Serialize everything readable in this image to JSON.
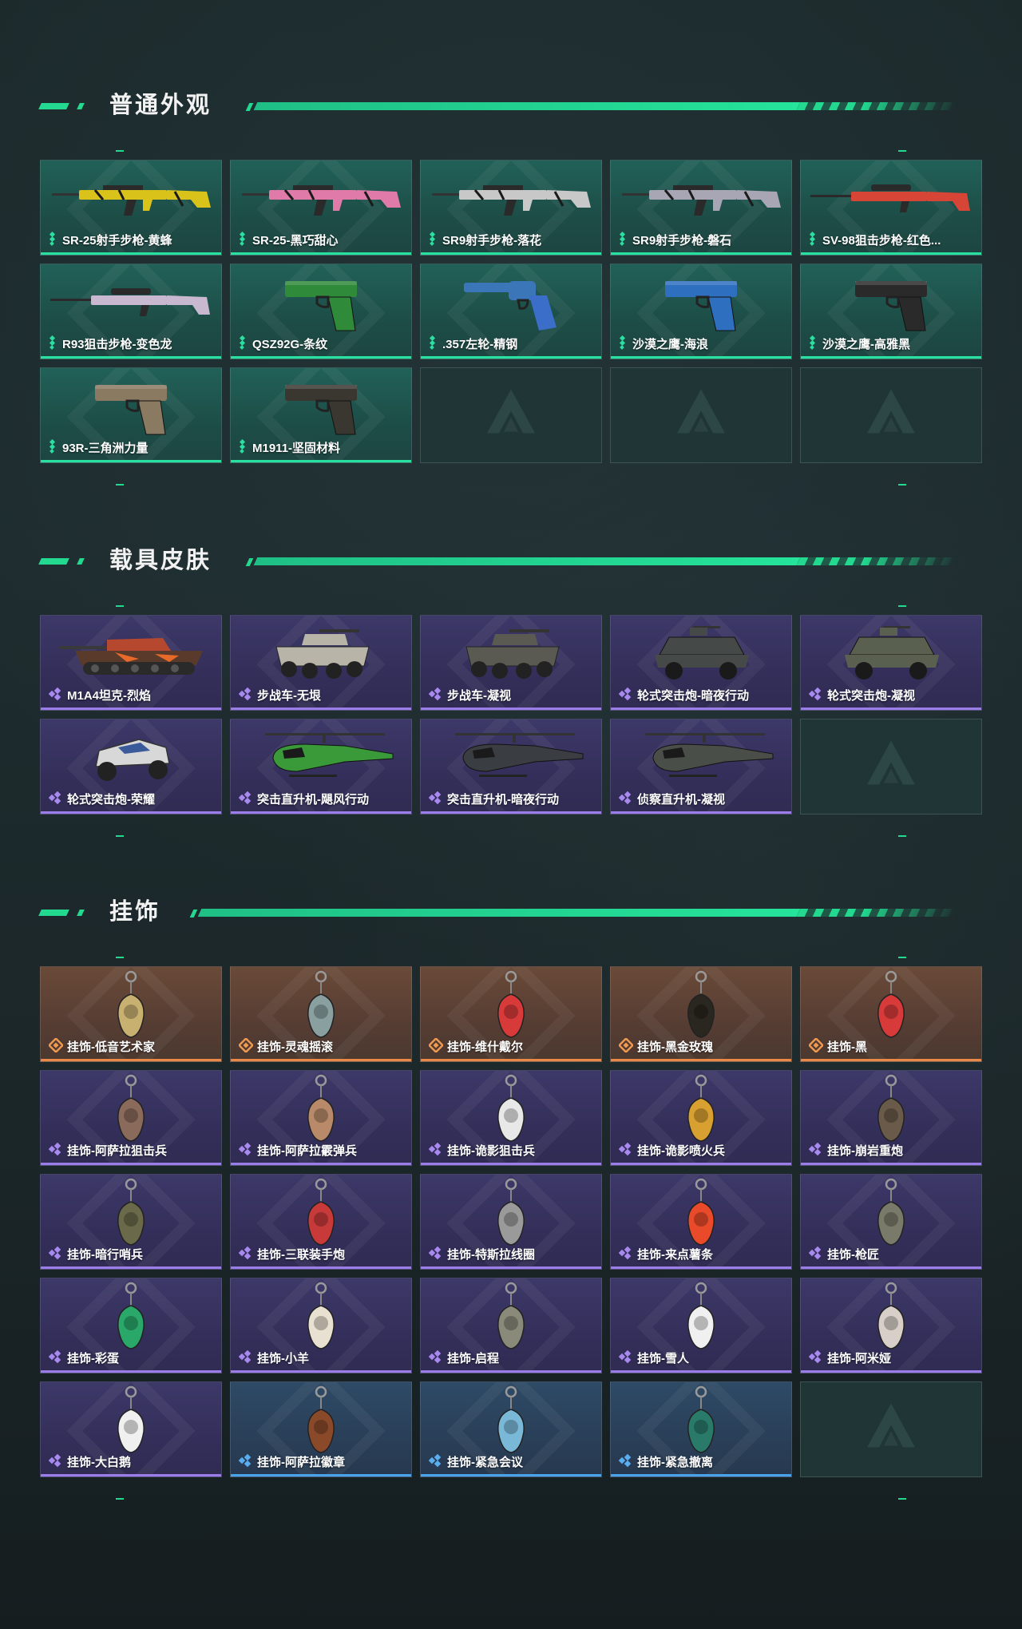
{
  "sections": [
    {
      "title": "普通外观",
      "cards": [
        {
          "label": "SR-25射手步枪-黄蜂",
          "rarity": "green",
          "icon": "rifle-icon",
          "color": "#d9c21a"
        },
        {
          "label": "SR-25-黑巧甜心",
          "rarity": "green",
          "icon": "rifle-icon",
          "color": "#e07aa8"
        },
        {
          "label": "SR9射手步枪-落花",
          "rarity": "green",
          "icon": "rifle-icon",
          "color": "#c8c8c8"
        },
        {
          "label": "SR9射手步枪-磐石",
          "rarity": "green",
          "icon": "rifle-icon",
          "color": "#a8a6b4"
        },
        {
          "label": "SV-98狙击步枪-红色...",
          "rarity": "green",
          "icon": "sniper-icon",
          "color": "#d64535"
        },
        {
          "label": "R93狙击步枪-变色龙",
          "rarity": "green",
          "icon": "sniper-icon",
          "color": "#c8b8d0"
        },
        {
          "label": "QSZ92G-条纹",
          "rarity": "green",
          "icon": "pistol-icon",
          "color": "#2f8a3a"
        },
        {
          "label": ".357左轮-精钢",
          "rarity": "green",
          "icon": "revolver-icon",
          "color": "#3a76b8"
        },
        {
          "label": "沙漠之鹰-海浪",
          "rarity": "green",
          "icon": "pistol-icon",
          "color": "#2f6fc0"
        },
        {
          "label": "沙漠之鹰-高雅黑",
          "rarity": "green",
          "icon": "pistol-icon",
          "color": "#2a2a2a"
        },
        {
          "label": "93R-三角洲力量",
          "rarity": "green",
          "icon": "pistol-icon",
          "color": "#8a7a62"
        },
        {
          "label": "M1911-坚固材料",
          "rarity": "green",
          "icon": "pistol-icon",
          "color": "#3a3630"
        },
        {
          "label": "",
          "rarity": "empty"
        },
        {
          "label": "",
          "rarity": "empty"
        },
        {
          "label": "",
          "rarity": "empty"
        }
      ]
    },
    {
      "title": "载具皮肤",
      "cards": [
        {
          "label": "M1A4坦克-烈焰",
          "rarity": "purple",
          "icon": "tank-icon",
          "color": "#b5482e"
        },
        {
          "label": "步战车-无垠",
          "rarity": "purple",
          "icon": "ifv-icon",
          "color": "#b8b4a8"
        },
        {
          "label": "步战车-凝视",
          "rarity": "purple",
          "icon": "ifv-icon",
          "color": "#5a5a52"
        },
        {
          "label": "轮式突击炮-暗夜行动",
          "rarity": "purple",
          "icon": "armored-car-icon",
          "color": "#454a48"
        },
        {
          "label": "轮式突击炮-凝视",
          "rarity": "purple",
          "icon": "armored-car-icon",
          "color": "#5a6050"
        },
        {
          "label": "轮式突击炮-荣耀",
          "rarity": "purple",
          "icon": "buggy-icon",
          "color": "#d8d8d8"
        },
        {
          "label": "突击直升机-飓风行动",
          "rarity": "purple",
          "icon": "helicopter-icon",
          "color": "#3a9a3a"
        },
        {
          "label": "突击直升机-暗夜行动",
          "rarity": "purple",
          "icon": "helicopter-icon",
          "color": "#3a3e42"
        },
        {
          "label": "侦察直升机-凝视",
          "rarity": "purple",
          "icon": "helicopter-icon",
          "color": "#4a4e48"
        },
        {
          "label": "",
          "rarity": "empty"
        }
      ]
    },
    {
      "title": "挂饰",
      "cards": [
        {
          "label": "挂饰-低音艺术家",
          "rarity": "orange",
          "icon": "charm-icon",
          "color": "#c8b070"
        },
        {
          "label": "挂饰-灵魂摇滚",
          "rarity": "orange",
          "icon": "charm-icon",
          "color": "#8aa0a0"
        },
        {
          "label": "挂饰-维什戴尔",
          "rarity": "orange",
          "icon": "charm-icon",
          "color": "#d83a3a"
        },
        {
          "label": "挂饰-黑金玫瑰",
          "rarity": "orange",
          "icon": "charm-icon",
          "color": "#2a2620"
        },
        {
          "label": "挂饰-黑",
          "rarity": "orange",
          "icon": "charm-icon",
          "color": "#d83a3a"
        },
        {
          "label": "挂饰-阿萨拉狙击兵",
          "rarity": "purple",
          "icon": "charm-icon",
          "color": "#8a6a5a"
        },
        {
          "label": "挂饰-阿萨拉霰弹兵",
          "rarity": "purple",
          "icon": "charm-icon",
          "color": "#b88a6a"
        },
        {
          "label": "挂饰-诡影狙击兵",
          "rarity": "purple",
          "icon": "charm-icon",
          "color": "#e8e8e8"
        },
        {
          "label": "挂饰-诡影喷火兵",
          "rarity": "purple",
          "icon": "charm-icon",
          "color": "#d8a030"
        },
        {
          "label": "挂饰-崩岩重炮",
          "rarity": "purple",
          "icon": "charm-icon",
          "color": "#6a5a4a"
        },
        {
          "label": "挂饰-暗行哨兵",
          "rarity": "purple",
          "icon": "charm-icon",
          "color": "#6a6a4a"
        },
        {
          "label": "挂饰-三联装手炮",
          "rarity": "purple",
          "icon": "charm-icon",
          "color": "#c83a3a"
        },
        {
          "label": "挂饰-特斯拉线圈",
          "rarity": "purple",
          "icon": "charm-icon",
          "color": "#9a9a9a"
        },
        {
          "label": "挂饰-来点薯条",
          "rarity": "purple",
          "icon": "charm-icon",
          "color": "#e84a2a"
        },
        {
          "label": "挂饰-枪匠",
          "rarity": "purple",
          "icon": "charm-icon",
          "color": "#7a7a6a"
        },
        {
          "label": "挂饰-彩蛋",
          "rarity": "purple",
          "icon": "charm-icon",
          "color": "#2aa86a"
        },
        {
          "label": "挂饰-小羊",
          "rarity": "purple",
          "icon": "charm-icon",
          "color": "#e8e0d0"
        },
        {
          "label": "挂饰-启程",
          "rarity": "purple",
          "icon": "charm-icon",
          "color": "#8a8a7a"
        },
        {
          "label": "挂饰-雪人",
          "rarity": "purple",
          "icon": "charm-icon",
          "color": "#f0f0f0"
        },
        {
          "label": "挂饰-阿米娅",
          "rarity": "purple",
          "icon": "charm-icon",
          "color": "#d8d0c8"
        },
        {
          "label": "挂饰-大白鹅",
          "rarity": "purple",
          "icon": "charm-icon",
          "color": "#f0f0f0"
        },
        {
          "label": "挂饰-阿萨拉徽章",
          "rarity": "blue",
          "icon": "charm-icon",
          "color": "#8a4a2a"
        },
        {
          "label": "挂饰-紧急会议",
          "rarity": "blue",
          "icon": "charm-icon",
          "color": "#7ab8d8"
        },
        {
          "label": "挂饰-紧急撤离",
          "rarity": "blue",
          "icon": "charm-icon",
          "color": "#2a7a6a"
        },
        {
          "label": "",
          "rarity": "empty"
        }
      ]
    }
  ]
}
